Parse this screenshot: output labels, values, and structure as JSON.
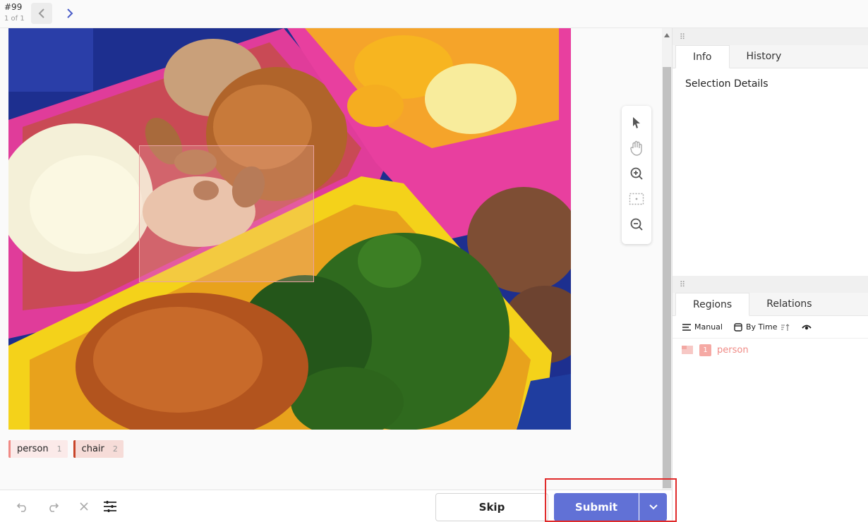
{
  "header": {
    "task_id": "#99",
    "task_count": "1 of 1"
  },
  "labels": [
    {
      "name": "person",
      "hotkey": "1",
      "color": "#f08a85"
    },
    {
      "name": "chair",
      "hotkey": "2",
      "color": "#c8452a"
    }
  ],
  "right_panel": {
    "top_tabs": [
      "Info",
      "History"
    ],
    "selection_details": "Selection Details",
    "bottom_tabs": [
      "Regions",
      "Relations"
    ],
    "order_manual": "Manual",
    "order_by_time": "By Time",
    "regions": [
      {
        "index": "1",
        "label": "person"
      }
    ]
  },
  "actions": {
    "skip_label": "Skip",
    "submit_label": "Submit"
  },
  "colors": {
    "accent": "#6171d6",
    "person": "#f08a85",
    "chair": "#c8452a",
    "highlight": "#e02b2b"
  }
}
